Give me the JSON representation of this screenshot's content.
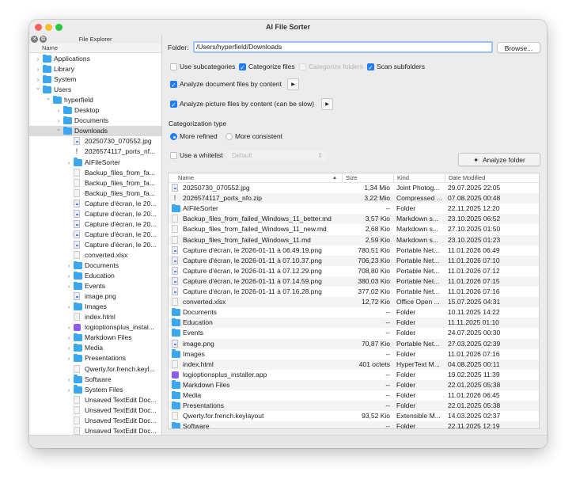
{
  "window": {
    "title": "AI File Sorter"
  },
  "sidebar": {
    "title": "File Explorer",
    "column": "Name",
    "items": [
      {
        "level": 0,
        "expander": "collapsed",
        "icon": "folder",
        "label": "Applications"
      },
      {
        "level": 0,
        "expander": "collapsed",
        "icon": "folder",
        "label": "Library"
      },
      {
        "level": 0,
        "expander": "collapsed",
        "icon": "folder",
        "label": "System"
      },
      {
        "level": 0,
        "expander": "expanded",
        "icon": "folder",
        "label": "Users"
      },
      {
        "level": 1,
        "expander": "expanded",
        "icon": "folder",
        "label": "hyperfield"
      },
      {
        "level": 2,
        "expander": "collapsed",
        "icon": "folder",
        "label": "Desktop"
      },
      {
        "level": 2,
        "expander": "collapsed",
        "icon": "folder",
        "label": "Documents"
      },
      {
        "level": 2,
        "expander": "expanded",
        "icon": "folder",
        "label": "Downloads",
        "selected": true
      },
      {
        "level": 3,
        "expander": "none",
        "icon": "image",
        "label": "20250730_070552.jpg"
      },
      {
        "level": 3,
        "expander": "none",
        "icon": "zip",
        "label": "2026574117_ports_nf..."
      },
      {
        "level": 3,
        "expander": "collapsed",
        "icon": "folder",
        "label": "AIFileSorter"
      },
      {
        "level": 3,
        "expander": "none",
        "icon": "file",
        "label": "Backup_files_from_fa..."
      },
      {
        "level": 3,
        "expander": "none",
        "icon": "file",
        "label": "Backup_files_from_fa..."
      },
      {
        "level": 3,
        "expander": "none",
        "icon": "file",
        "label": "Backup_files_from_fa..."
      },
      {
        "level": 3,
        "expander": "none",
        "icon": "image",
        "label": "Capture d'écran, le 20..."
      },
      {
        "level": 3,
        "expander": "none",
        "icon": "image",
        "label": "Capture d'écran, le 20..."
      },
      {
        "level": 3,
        "expander": "none",
        "icon": "image",
        "label": "Capture d'écran, le 20..."
      },
      {
        "level": 3,
        "expander": "none",
        "icon": "image",
        "label": "Capture d'écran, le 20..."
      },
      {
        "level": 3,
        "expander": "none",
        "icon": "image",
        "label": "Capture d'écran, le 20..."
      },
      {
        "level": 3,
        "expander": "none",
        "icon": "file",
        "label": "converted.xlsx"
      },
      {
        "level": 3,
        "expander": "collapsed",
        "icon": "folder",
        "label": "Documents"
      },
      {
        "level": 3,
        "expander": "collapsed",
        "icon": "folder",
        "label": "Education"
      },
      {
        "level": 3,
        "expander": "collapsed",
        "icon": "folder",
        "label": "Events"
      },
      {
        "level": 3,
        "expander": "none",
        "icon": "image",
        "label": "image.png"
      },
      {
        "level": 3,
        "expander": "collapsed",
        "icon": "folder",
        "label": "Images"
      },
      {
        "level": 3,
        "expander": "none",
        "icon": "file",
        "label": "index.html"
      },
      {
        "level": 3,
        "expander": "collapsed",
        "icon": "app",
        "label": "logioptionsplus_instal..."
      },
      {
        "level": 3,
        "expander": "collapsed",
        "icon": "folder",
        "label": "Markdown Files"
      },
      {
        "level": 3,
        "expander": "collapsed",
        "icon": "folder",
        "label": "Media"
      },
      {
        "level": 3,
        "expander": "collapsed",
        "icon": "folder",
        "label": "Presentations"
      },
      {
        "level": 3,
        "expander": "none",
        "icon": "file",
        "label": "Qwerty.for.french.keyl..."
      },
      {
        "level": 3,
        "expander": "collapsed",
        "icon": "folder",
        "label": "Software"
      },
      {
        "level": 3,
        "expander": "collapsed",
        "icon": "folder",
        "label": "System Files"
      },
      {
        "level": 3,
        "expander": "none",
        "icon": "file",
        "label": "Unsaved TextEdit Doc..."
      },
      {
        "level": 3,
        "expander": "none",
        "icon": "file",
        "label": "Unsaved TextEdit Doc..."
      },
      {
        "level": 3,
        "expander": "none",
        "icon": "file",
        "label": "Unsaved TextEdit Doc..."
      },
      {
        "level": 3,
        "expander": "none",
        "icon": "file",
        "label": "Unsaved TextEdit Doc..."
      }
    ]
  },
  "folder": {
    "label": "Folder:",
    "value": "/Users/hyperfield/Downloads",
    "browse": "Browse..."
  },
  "options": {
    "use_subcategories": {
      "label": "Use subcategories",
      "checked": false
    },
    "categorize_files": {
      "label": "Categorize files",
      "checked": true
    },
    "categorize_folders": {
      "label": "Categorize folders",
      "checked": false,
      "disabled": true
    },
    "scan_subfolders": {
      "label": "Scan subfolders",
      "checked": true
    },
    "analyze_documents": {
      "label": "Analyze document files by content",
      "checked": true
    },
    "analyze_pictures": {
      "label": "Analyze picture files by content (can be slow)",
      "checked": true
    }
  },
  "categorization": {
    "title": "Categorization type",
    "refined": "More refined",
    "consistent": "More consistent",
    "selected": "More refined"
  },
  "whitelist": {
    "label": "Use a whitelist",
    "checked": false,
    "select_value": "Default"
  },
  "analyze_button": "Analyze folder",
  "table": {
    "columns": [
      "Name",
      "Size",
      "Kind",
      "Date Modified"
    ],
    "sort_column": "Name",
    "rows": [
      {
        "icon": "image",
        "name": "20250730_070552.jpg",
        "size": "1,34 Mio",
        "kind": "Joint Photog...",
        "date": "29.07.2025 22:05"
      },
      {
        "icon": "zip",
        "name": "2026574117_ports_nfo.zip",
        "size": "3,22 Mio",
        "kind": "Compressed ...",
        "date": "07.08.2025 00:48"
      },
      {
        "icon": "folder",
        "name": "AIFileSorter",
        "size": "--",
        "kind": "Folder",
        "date": "22.11.2025 12:20"
      },
      {
        "icon": "file",
        "name": "Backup_files_from_failed_Windows_11_better.md",
        "size": "3,57 Kio",
        "kind": "Markdown s...",
        "date": "23.10.2025 06:52"
      },
      {
        "icon": "file",
        "name": "Backup_files_from_failed_Windows_11_new.md",
        "size": "2,68 Kio",
        "kind": "Markdown s...",
        "date": "27.10.2025 01:50"
      },
      {
        "icon": "file",
        "name": "Backup_files_from_failed_Windows_11.md",
        "size": "2,59 Kio",
        "kind": "Markdown s...",
        "date": "23.10.2025 01:23"
      },
      {
        "icon": "image",
        "name": "Capture d'écran, le 2026-01-11 à 06.49.19.png",
        "size": "780,51 Kio",
        "kind": "Portable Net...",
        "date": "11.01.2026 06:49"
      },
      {
        "icon": "image",
        "name": "Capture d'écran, le 2026-01-11 à 07.10.37.png",
        "size": "706,23 Kio",
        "kind": "Portable Net...",
        "date": "11.01.2026 07:10"
      },
      {
        "icon": "image",
        "name": "Capture d'écran, le 2026-01-11 à 07.12.29.png",
        "size": "708,80 Kio",
        "kind": "Portable Net...",
        "date": "11.01.2026 07:12"
      },
      {
        "icon": "image",
        "name": "Capture d'écran, le 2026-01-11 à 07.14.59.png",
        "size": "380,03 Kio",
        "kind": "Portable Net...",
        "date": "11.01.2026 07:15"
      },
      {
        "icon": "image",
        "name": "Capture d'écran, le 2026-01-11 à 07.16.28.png",
        "size": "377,02 Kio",
        "kind": "Portable Net...",
        "date": "11.01.2026 07:16"
      },
      {
        "icon": "file",
        "name": "converted.xlsx",
        "size": "12,72 Kio",
        "kind": "Office Open ...",
        "date": "15.07.2025 04:31"
      },
      {
        "icon": "folder",
        "name": "Documents",
        "size": "--",
        "kind": "Folder",
        "date": "10.11.2025 14:22"
      },
      {
        "icon": "folder",
        "name": "Education",
        "size": "--",
        "kind": "Folder",
        "date": "11.11.2025 01:10"
      },
      {
        "icon": "folder",
        "name": "Events",
        "size": "--",
        "kind": "Folder",
        "date": "24.07.2025 00:30"
      },
      {
        "icon": "image",
        "name": "image.png",
        "size": "70,87 Kio",
        "kind": "Portable Net...",
        "date": "27.03.2025 02:39"
      },
      {
        "icon": "folder",
        "name": "Images",
        "size": "--",
        "kind": "Folder",
        "date": "11.01.2026 07:16"
      },
      {
        "icon": "file",
        "name": "index.html",
        "size": "401 octets",
        "kind": "HyperText M...",
        "date": "04.08.2025 00:11"
      },
      {
        "icon": "app",
        "name": "logioptionsplus_installer.app",
        "size": "--",
        "kind": "Folder",
        "date": "19.02.2025 11:39"
      },
      {
        "icon": "folder",
        "name": "Markdown Files",
        "size": "--",
        "kind": "Folder",
        "date": "22.01.2025 05:38"
      },
      {
        "icon": "folder",
        "name": "Media",
        "size": "--",
        "kind": "Folder",
        "date": "11.01.2026 06:45"
      },
      {
        "icon": "folder",
        "name": "Presentations",
        "size": "--",
        "kind": "Folder",
        "date": "22.01.2025 05:38"
      },
      {
        "icon": "file",
        "name": "Qwerty.for.french.keylayout",
        "size": "93,52 Kio",
        "kind": "Extensible M...",
        "date": "14.03.2025 02:37"
      },
      {
        "icon": "folder",
        "name": "Software",
        "size": "--",
        "kind": "Folder",
        "date": "22.11.2025 12:19"
      }
    ]
  },
  "colors": {
    "accent": "#1f7bf6",
    "folder": "#3ba7ee",
    "app": "#8c5cf0"
  }
}
